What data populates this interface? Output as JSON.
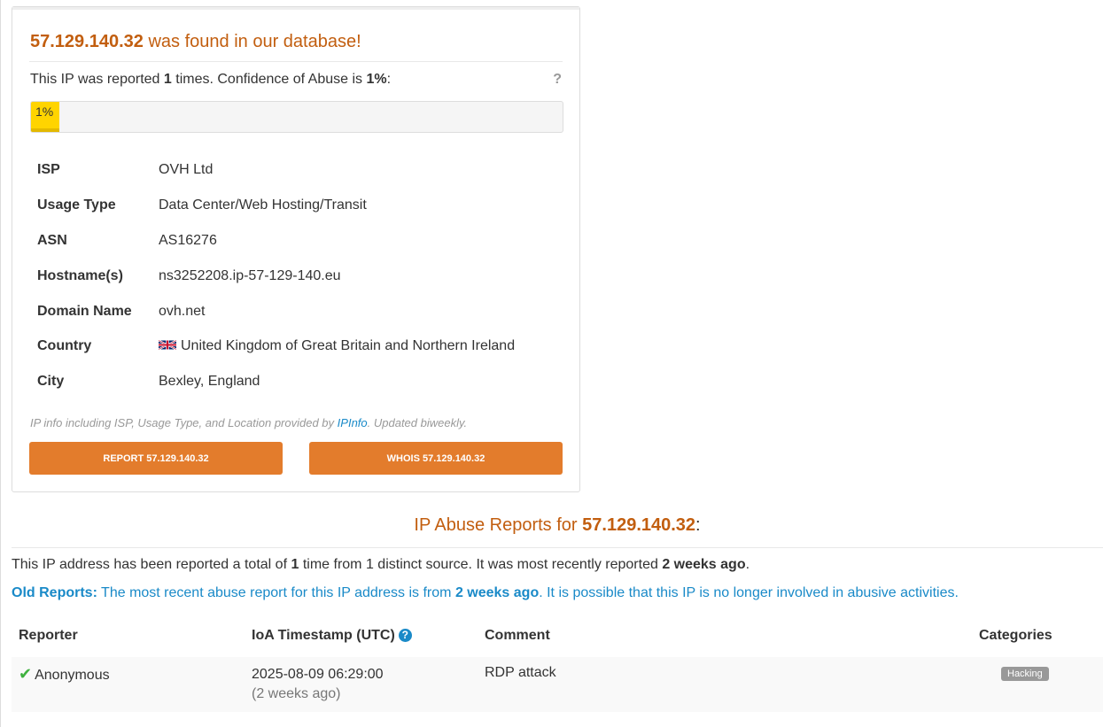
{
  "ip": "57.129.140.32",
  "panel": {
    "heading_suffix": "was found in our database!",
    "summary": {
      "prefix": "This IP was reported",
      "count": "1",
      "middle": "times. Confidence of Abuse is",
      "confidence": "1%",
      "suffix": ":"
    },
    "help": "?",
    "progress": {
      "value": 0.01,
      "label": "1%"
    },
    "info": [
      {
        "key": "ISP",
        "value": "OVH Ltd"
      },
      {
        "key": "Usage Type",
        "value": "Data Center/Web Hosting/Transit"
      },
      {
        "key": "ASN",
        "value": "AS16276"
      },
      {
        "key": "Hostname(s)",
        "value": "ns3252208.ip-57-129-140.eu"
      },
      {
        "key": "Domain Name",
        "value": "ovh.net"
      },
      {
        "key": "Country",
        "value": "United Kingdom of Great Britain and Northern Ireland",
        "icon": "uk-flag-icon"
      },
      {
        "key": "City",
        "value": "Bexley, England"
      }
    ],
    "provider_note": {
      "prefix": "IP info including ISP, Usage Type, and Location provided by",
      "link": "IPInfo",
      "suffix": ". Updated biweekly."
    },
    "buttons": {
      "report": "REPORT 57.129.140.32",
      "whois": "WHOIS 57.129.140.32"
    }
  },
  "reports": {
    "heading_prefix": "IP Abuse Reports for",
    "heading_colon": ":",
    "total": {
      "prefix": "This IP address has been reported a total of",
      "count": "1",
      "middle": "time from 1 distinct source. It was most recently reported",
      "recent": "2 weeks ago",
      "suffix": "."
    },
    "old": {
      "label": "Old Reports:",
      "prefix": "The most recent abuse report for this IP address is from",
      "recent": "2 weeks ago",
      "suffix": ". It is possible that this IP is no longer involved in abusive activities."
    },
    "columns": {
      "reporter": "Reporter",
      "timestamp": "IoA Timestamp (UTC)",
      "comment": "Comment",
      "categories": "Categories"
    },
    "rows": [
      {
        "reporter": "Anonymous",
        "timestamp": "2025-08-09 06:29:00",
        "ago": "(2 weeks ago)",
        "comment": "RDP attack",
        "category": "Hacking"
      }
    ]
  },
  "colors": {
    "accent": "#c25e0f",
    "button": "#e37c2c",
    "link": "#1a8ac8",
    "progress": "#ffd400"
  }
}
